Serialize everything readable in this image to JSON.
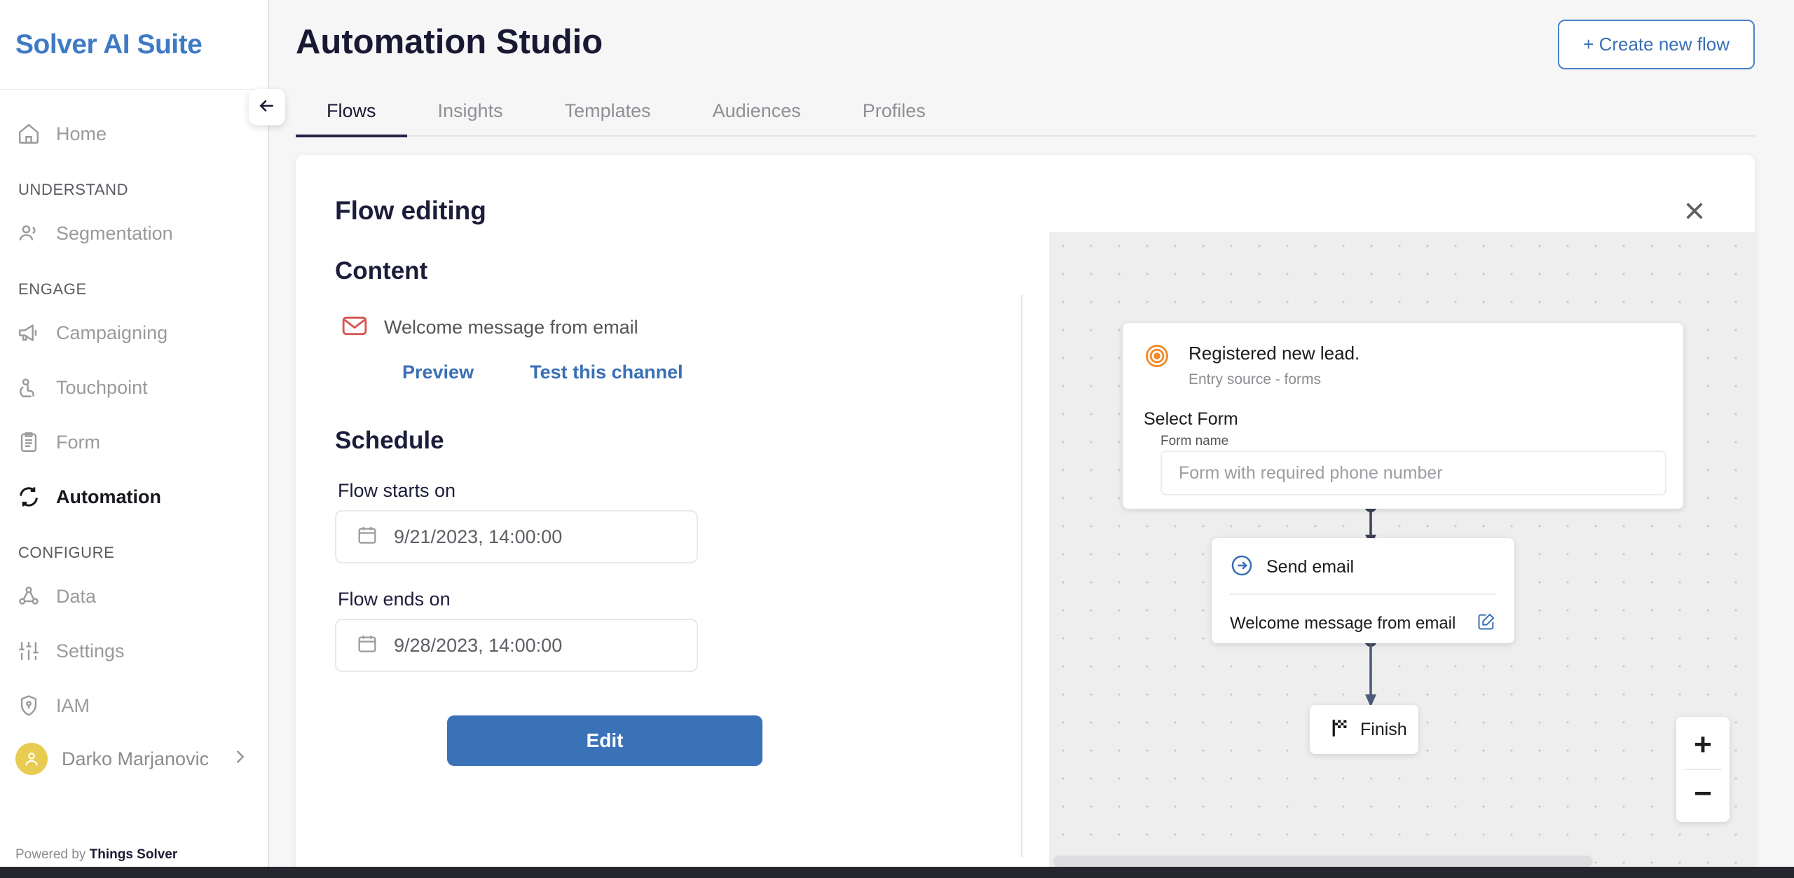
{
  "sidebar": {
    "brand": "Solver AI Suite",
    "items": [
      {
        "label": "Home",
        "icon": "home-icon",
        "active": false
      },
      {
        "section": "UNDERSTAND"
      },
      {
        "label": "Segmentation",
        "icon": "users-icon",
        "active": false
      },
      {
        "section": "ENGAGE"
      },
      {
        "label": "Campaigning",
        "icon": "megaphone-icon",
        "active": false
      },
      {
        "label": "Touchpoint",
        "icon": "touch-icon",
        "active": false
      },
      {
        "label": "Form",
        "icon": "clipboard-icon",
        "active": false
      },
      {
        "label": "Automation",
        "icon": "automation-icon",
        "active": true
      },
      {
        "section": "CONFIGURE"
      },
      {
        "label": "Data",
        "icon": "data-graph-icon",
        "active": false
      },
      {
        "label": "Settings",
        "icon": "sliders-icon",
        "active": false
      },
      {
        "label": "IAM",
        "icon": "shield-key-icon",
        "active": false
      }
    ],
    "user": {
      "name": "Darko Marjanovic"
    },
    "footer_prefix": "Powered by ",
    "footer_brand": "Things Solver"
  },
  "header": {
    "title": "Automation Studio",
    "create_button": "+ Create new flow"
  },
  "tabs": [
    {
      "label": "Flows",
      "active": true
    },
    {
      "label": "Insights",
      "active": false
    },
    {
      "label": "Templates",
      "active": false
    },
    {
      "label": "Audiences",
      "active": false
    },
    {
      "label": "Profiles",
      "active": false
    }
  ],
  "panel": {
    "title": "Flow editing",
    "content": {
      "heading": "Content",
      "channel_label": "Welcome message from email",
      "preview_link": "Preview",
      "test_link": "Test this channel"
    },
    "schedule": {
      "heading": "Schedule",
      "start_label": "Flow starts on",
      "start_value": "9/21/2023, 14:00:00",
      "end_label": "Flow ends on",
      "end_value": "9/28/2023, 14:00:00"
    },
    "edit_button": "Edit"
  },
  "canvas": {
    "trigger_node": {
      "title": "Registered new lead.",
      "subtitle": "Entry source - forms",
      "select_label": "Select Form",
      "field_label": "Form name",
      "field_placeholder": "Form with required phone number"
    },
    "email_node": {
      "title": "Send email",
      "message": "Welcome message from email"
    },
    "finish_node": {
      "label": "Finish"
    },
    "zoom_in": "+",
    "zoom_out": "−"
  },
  "colors": {
    "brand_blue": "#3f7ac4",
    "link_blue": "#3a6fb5",
    "primary_button": "#3a72b8",
    "accent_orange": "#f08a25",
    "avatar_yellow": "#e8cc52",
    "email_red": "#d9534f",
    "title_navy": "#191933"
  }
}
